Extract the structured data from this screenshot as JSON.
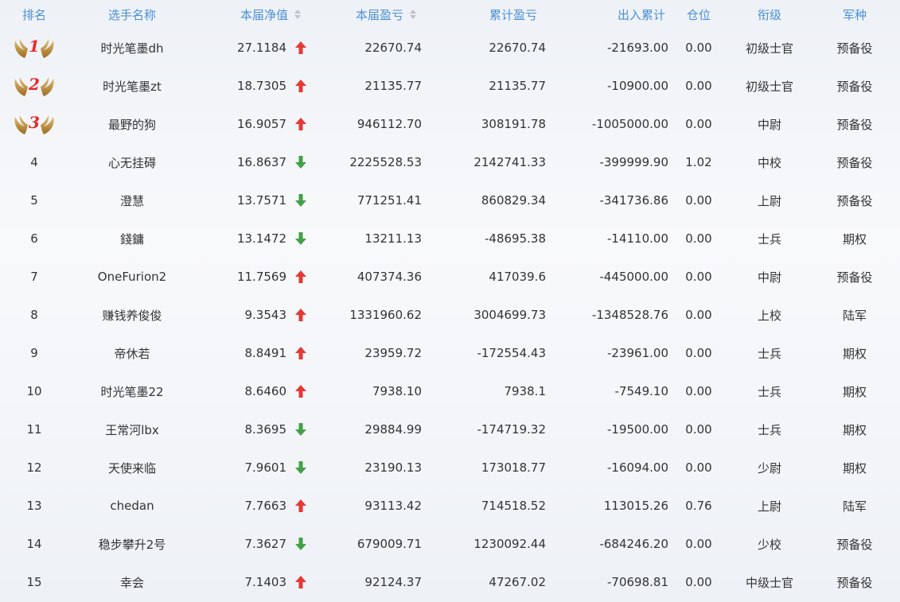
{
  "header": {
    "rank": "排名",
    "name": "选手名称",
    "nav": "本届净值",
    "current_pnl": "本届盈亏",
    "cumulative_pnl": "累计盈亏",
    "in_out_total": "出入累计",
    "position": "仓位",
    "military_rank": "衔级",
    "branch": "军种"
  },
  "colors": {
    "header": "#4a90d9",
    "up": "#e53935",
    "down": "#43a047",
    "medal_number": "#e52b2b"
  },
  "icons": {
    "sort": "sort-caret-icon",
    "medal": "wings-medal-icon",
    "up": "arrow-up-icon",
    "down": "arrow-down-icon"
  },
  "rows": [
    {
      "rank": "1",
      "name": "时光笔墨dh",
      "nav": "27.1184",
      "trend": "up",
      "cur": "22670.74",
      "cum": "22670.74",
      "io": "-21693.00",
      "pos": "0.00",
      "mil": "初级士官",
      "arm": "预备役"
    },
    {
      "rank": "2",
      "name": "时光笔墨zt",
      "nav": "18.7305",
      "trend": "up",
      "cur": "21135.77",
      "cum": "21135.77",
      "io": "-10900.00",
      "pos": "0.00",
      "mil": "初级士官",
      "arm": "预备役"
    },
    {
      "rank": "3",
      "name": "最野的狗",
      "nav": "16.9057",
      "trend": "up",
      "cur": "946112.70",
      "cum": "308191.78",
      "io": "-1005000.00",
      "pos": "0.00",
      "mil": "中尉",
      "arm": "预备役"
    },
    {
      "rank": "4",
      "name": "心无挂碍",
      "nav": "16.8637",
      "trend": "down",
      "cur": "2225528.53",
      "cum": "2142741.33",
      "io": "-399999.90",
      "pos": "1.02",
      "mil": "中校",
      "arm": "预备役"
    },
    {
      "rank": "5",
      "name": "澄慧",
      "nav": "13.7571",
      "trend": "down",
      "cur": "771251.41",
      "cum": "860829.34",
      "io": "-341736.86",
      "pos": "0.00",
      "mil": "上尉",
      "arm": "预备役"
    },
    {
      "rank": "6",
      "name": "錢鏞",
      "nav": "13.1472",
      "trend": "down",
      "cur": "13211.13",
      "cum": "-48695.38",
      "io": "-14110.00",
      "pos": "0.00",
      "mil": "士兵",
      "arm": "期权"
    },
    {
      "rank": "7",
      "name": "OneFurion2",
      "nav": "11.7569",
      "trend": "up",
      "cur": "407374.36",
      "cum": "417039.6",
      "io": "-445000.00",
      "pos": "0.00",
      "mil": "中尉",
      "arm": "预备役"
    },
    {
      "rank": "8",
      "name": "赚钱养俊俊",
      "nav": "9.3543",
      "trend": "up",
      "cur": "1331960.62",
      "cum": "3004699.73",
      "io": "-1348528.76",
      "pos": "0.00",
      "mil": "上校",
      "arm": "陆军"
    },
    {
      "rank": "9",
      "name": "帝休若",
      "nav": "8.8491",
      "trend": "up",
      "cur": "23959.72",
      "cum": "-172554.43",
      "io": "-23961.00",
      "pos": "0.00",
      "mil": "士兵",
      "arm": "期权"
    },
    {
      "rank": "10",
      "name": "时光笔墨22",
      "nav": "8.6460",
      "trend": "up",
      "cur": "7938.10",
      "cum": "7938.1",
      "io": "-7549.10",
      "pos": "0.00",
      "mil": "士兵",
      "arm": "期权"
    },
    {
      "rank": "11",
      "name": "王常河lbx",
      "nav": "8.3695",
      "trend": "down",
      "cur": "29884.99",
      "cum": "-174719.32",
      "io": "-19500.00",
      "pos": "0.00",
      "mil": "士兵",
      "arm": "期权"
    },
    {
      "rank": "12",
      "name": "天使来临",
      "nav": "7.9601",
      "trend": "down",
      "cur": "23190.13",
      "cum": "173018.77",
      "io": "-16094.00",
      "pos": "0.00",
      "mil": "少尉",
      "arm": "期权"
    },
    {
      "rank": "13",
      "name": "chedan",
      "nav": "7.7663",
      "trend": "up",
      "cur": "93113.42",
      "cum": "714518.52",
      "io": "113015.26",
      "pos": "0.76",
      "mil": "上尉",
      "arm": "陆军"
    },
    {
      "rank": "14",
      "name": "稳步攀升2号",
      "nav": "7.3627",
      "trend": "down",
      "cur": "679009.71",
      "cum": "1230092.44",
      "io": "-684246.20",
      "pos": "0.00",
      "mil": "少校",
      "arm": "预备役"
    },
    {
      "rank": "15",
      "name": "幸会",
      "nav": "7.1403",
      "trend": "up",
      "cur": "92124.37",
      "cum": "47267.02",
      "io": "-70698.81",
      "pos": "0.00",
      "mil": "中级士官",
      "arm": "预备役"
    }
  ]
}
